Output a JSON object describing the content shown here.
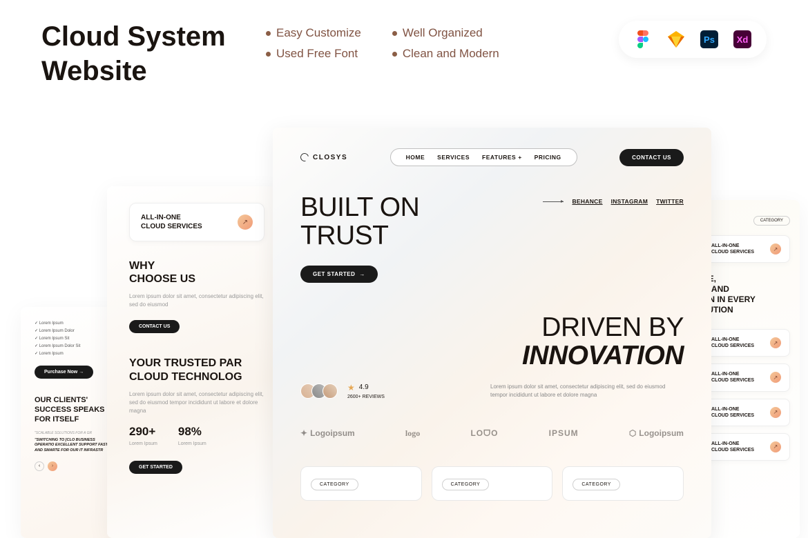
{
  "page_title_1": "Cloud System",
  "page_title_2": "Website",
  "features": [
    "Easy Customize",
    "Well Organized",
    "Used Free Font",
    "Clean and Modern"
  ],
  "mockup": {
    "brand": "CLOSYS",
    "nav": [
      "HOME",
      "SERVICES",
      "FEATURES",
      "PRICING"
    ],
    "contact_btn": "CONTACT US",
    "hero_1a": "BUILT ON",
    "hero_1b": "TRUST",
    "get_started": "GET STARTED",
    "socials": [
      "BEHANCE",
      "INSTAGRAM",
      "TWITTER"
    ],
    "hero_2a": "DRIVEN BY",
    "hero_2b": "INNOVATION",
    "lorem": "Lorem ipsum dolor sit amet, consectetur adipiscing elit, sed do eiusmod tempor incididunt ut labore et dolore magna",
    "rating": "4.9",
    "reviews": "2600+ REVIEWS",
    "logos": [
      "Logoipsum",
      "logo",
      "LOᗜO",
      "IPSUM",
      "Logoipsum"
    ],
    "category_label": "CATEGORY"
  },
  "left": {
    "service_1a": "ALL-IN-ONE",
    "service_1b": "CLOUD SERVICES",
    "why_1": "WHY",
    "why_2": "CHOOSE US",
    "lorem_short": "Lorem ipsum dolor sit amet, consectetur adipiscing elit, sed do eiusmod",
    "contact_btn": "CONTACT US",
    "trusted_1": "YOUR TRUSTED PAR",
    "trusted_2": "CLOUD TECHNOLOG",
    "lorem2": "Lorem ipsum dolor sit amet, consectetur adipiscing elit, sed do eiusmod tempor incididunt ut labore et dolore magna",
    "stat1_num": "290+",
    "stat1_label": "Lorem Ipsum",
    "stat2_num": "98%",
    "stat2_label": "Lorem Ipsum",
    "get_started": "GET STARTED"
  },
  "far_left": {
    "checks": [
      "Lorem Ipsum",
      "Lorem Ipsum Dolor",
      "Lorem Ipsum Sit",
      "Lorem Ipsum Dolor Sit",
      "Lorem Ipsum"
    ],
    "purchase": "Purchase Now",
    "success_1": "OUR CLIENTS'",
    "success_2": "SUCCESS SPEAKS",
    "success_3": "FOR ITSELF",
    "tag": "\"SCALABLE SOLUTIONS FOR A GR",
    "quote": "\"SWITCHING TO [CLO BUSINESS OPERATIO EXCELLENT SUPPORT FASTER AND SMARTE FOR OUR IT INFRASTR"
  },
  "right": {
    "category": "CATEGORY",
    "service_1a": "ALL-IN-ONE",
    "service_1b": "CLOUD SERVICES",
    "heading": "CE,\nY, AND\nON IN EVERY\nLUTION"
  }
}
